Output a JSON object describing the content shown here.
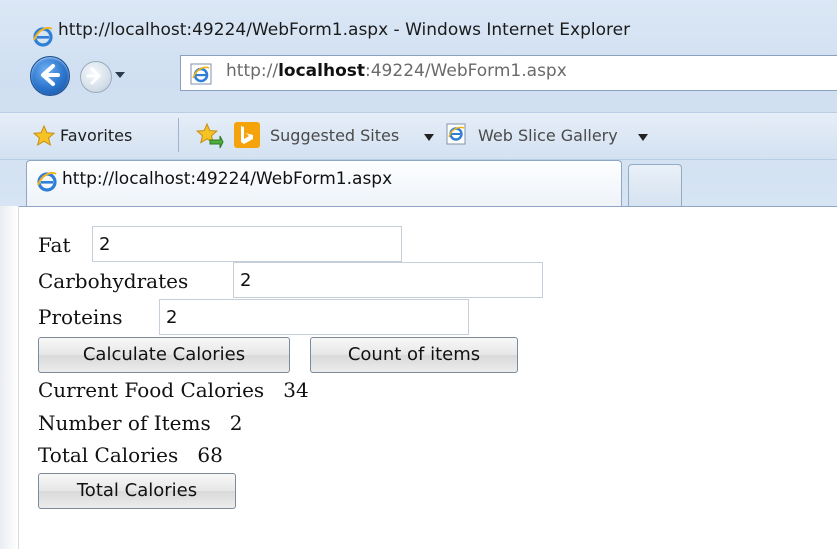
{
  "window": {
    "title": "http://localhost:49224/WebForm1.aspx - Windows Internet Explorer"
  },
  "navbar": {
    "address_prefix": "http://",
    "address_host": "localhost",
    "address_suffix": ":49224/WebForm1.aspx"
  },
  "favorites_bar": {
    "favorites_label": "Favorites",
    "suggested_sites_label": "Suggested Sites",
    "web_slice_gallery_label": "Web Slice Gallery"
  },
  "tabs": [
    {
      "label": "http://localhost:49224/WebForm1.aspx",
      "active": true
    }
  ],
  "form": {
    "fat_label": "Fat",
    "fat_value": "2",
    "carbohydrates_label": "Carbohydrates",
    "carbohydrates_value": "2",
    "proteins_label": "Proteins",
    "proteins_value": "2",
    "calculate_button": "Calculate Calories",
    "count_button": "Count of items",
    "current_food_calories_label": "Current Food Calories",
    "current_food_calories_value": "34",
    "number_of_items_label": "Number of Items",
    "number_of_items_value": "2",
    "total_calories_label": "Total Calories",
    "total_calories_value": "68",
    "total_calories_button": "Total Calories"
  },
  "icons": {
    "browser": "ie-icon",
    "back": "back-arrow-icon",
    "forward": "forward-arrow-icon",
    "favorites": "favorites-star-icon",
    "add_favorite": "add-favorite-icon",
    "bing": "bing-icon"
  },
  "colors": {
    "chrome_bg": "#d6e4f3",
    "accent_blue": "#2a73cc",
    "bing_orange": "#f5a30b"
  }
}
